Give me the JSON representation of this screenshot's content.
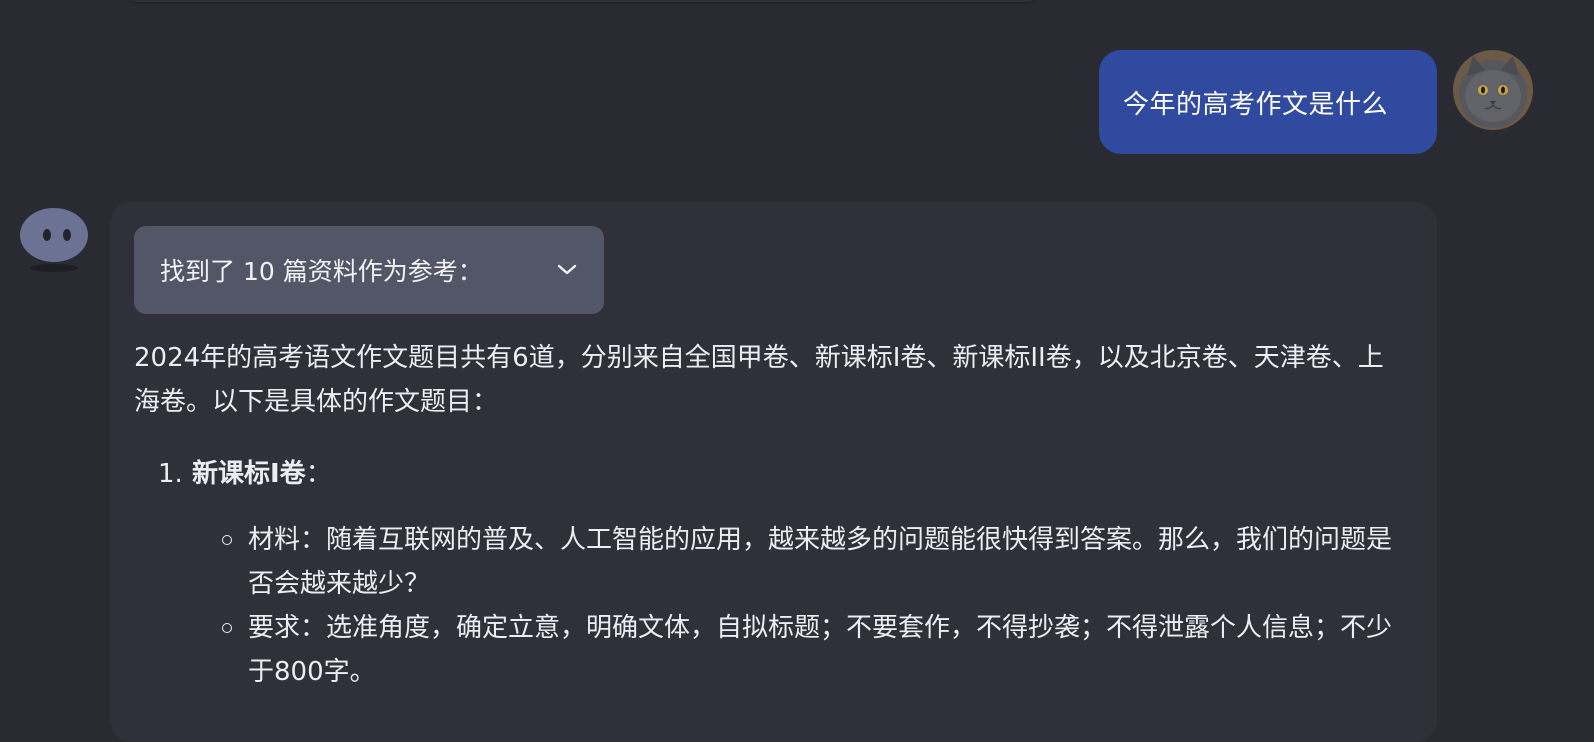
{
  "user_message": {
    "text": "今年的高考作文是什么"
  },
  "assistant": {
    "references_label": "找到了 10 篇资料作为参考：",
    "intro": "2024年的高考语文作文题目共有6道，分别来自全国甲卷、新课标I卷、新课标II卷，以及北京卷、天津卷、上海卷。以下是具体的作文题目：",
    "items": [
      {
        "number": "1.",
        "title": "新课标I卷",
        "suffix": "：",
        "points": [
          "材料：随着互联网的普及、人工智能的应用，越来越多的问题能很快得到答案。那么，我们的问题是否会越来越少？",
          "要求：选准角度，确定立意，明确文体，自拟标题；不要套作，不得抄袭；不得泄露个人信息；不少于800字。"
        ]
      }
    ]
  },
  "icons": {
    "user_avatar": "cat-avatar-icon",
    "bot_avatar": "bot-avatar-icon",
    "expand": "chevron-down-icon"
  },
  "colors": {
    "background": "#2a2a33",
    "card": "#30303b",
    "user_bubble": "#2f4a9e",
    "toggle": "#535666"
  }
}
